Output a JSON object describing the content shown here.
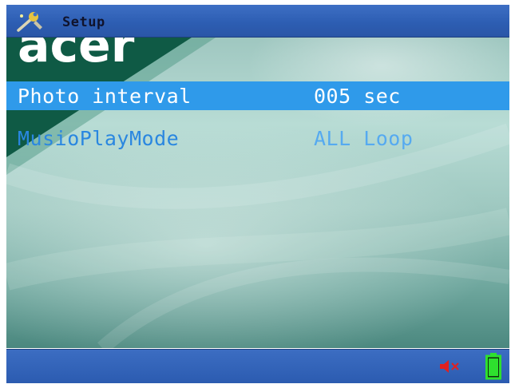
{
  "header": {
    "title": "Setup",
    "icon": "wrench-icon"
  },
  "menu": {
    "items": [
      {
        "label": "Photo interval",
        "value": "005 sec",
        "selected": true
      },
      {
        "label": "MusioPlayMode",
        "value": "ALL Loop",
        "selected": false
      }
    ]
  },
  "background": {
    "logo_text": "acer"
  },
  "status": {
    "mute_icon": "speaker-muted-icon",
    "battery_icon": "battery-icon",
    "mute_color": "#e02020",
    "battery_color": "#2ee02e"
  },
  "colors": {
    "bar": "#2d5eb3",
    "selection": "#2f9aea",
    "text_dim": "#2a87e0"
  }
}
